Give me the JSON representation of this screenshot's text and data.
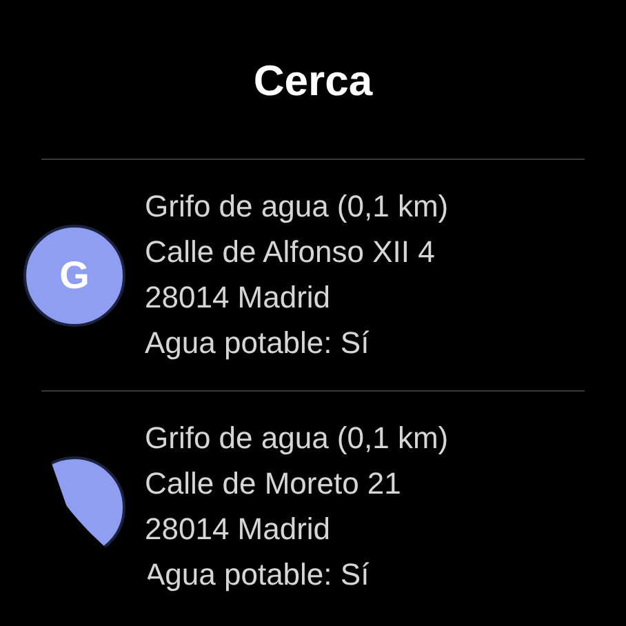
{
  "title": "Cerca",
  "places": [
    {
      "initial": "G",
      "lines": [
        "Grifo de agua (0,1 km)",
        "Calle de Alfonso XII 4",
        "28014 Madrid",
        "Agua potable: Sí"
      ]
    },
    {
      "lines": [
        "Grifo de agua (0,1 km)",
        "Calle de Moreto 21",
        "28014 Madrid",
        "Agua potable: Sí"
      ]
    }
  ]
}
